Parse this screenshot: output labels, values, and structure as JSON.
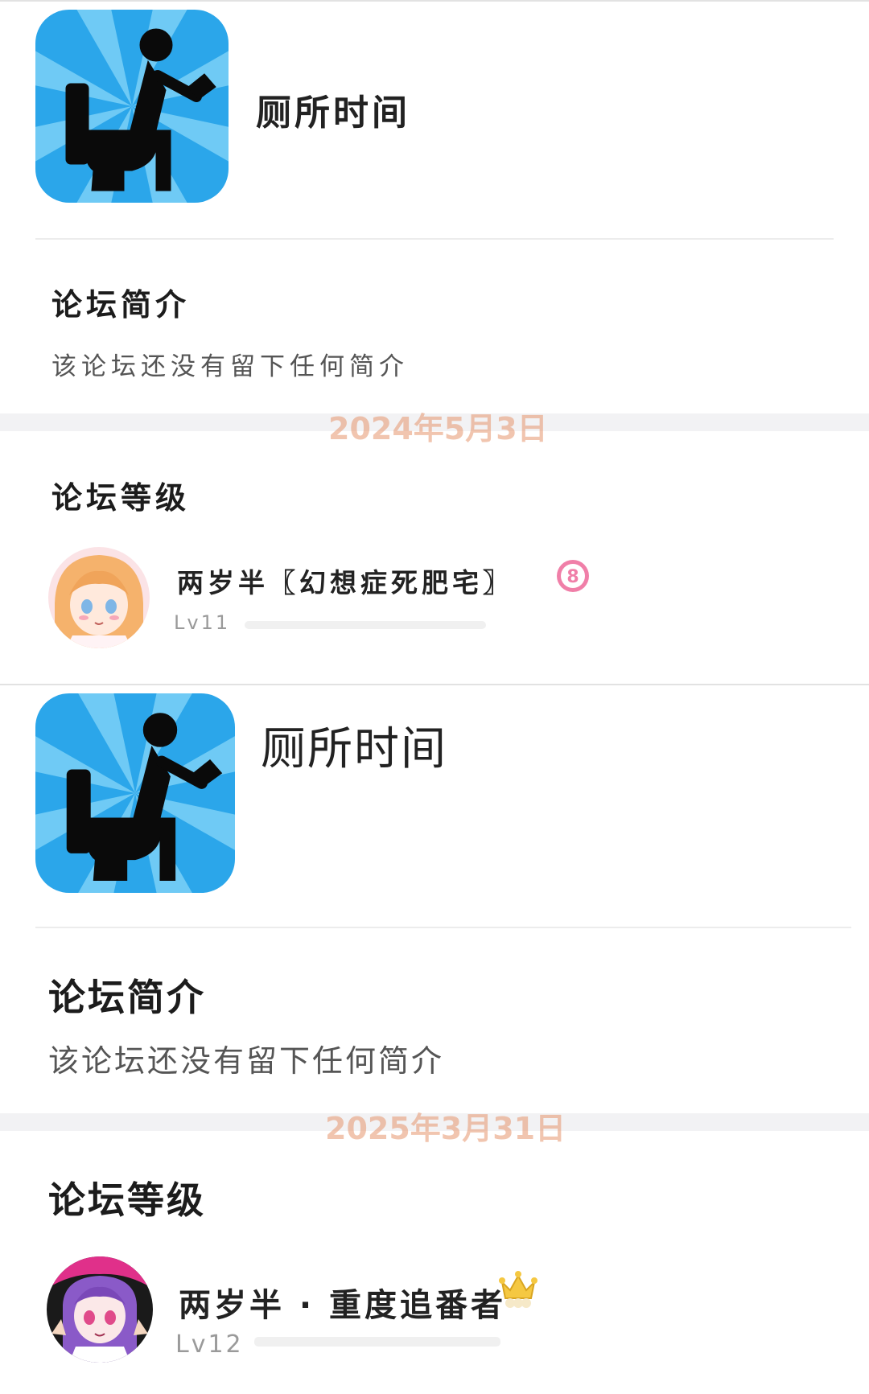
{
  "snapshots": [
    {
      "date": "2024年5月3日",
      "forum": {
        "name": "厕所时间",
        "icon": "toilet-reading-phone-icon"
      },
      "intro": {
        "title": "论坛简介",
        "text": "该论坛还没有留下任何简介"
      },
      "level_section": {
        "title": "论坛等级"
      },
      "user": {
        "name": "两岁半〖幻想症死肥宅〗",
        "level": "Lv11",
        "badge": {
          "icon": "number-8-badge-icon",
          "text": "8",
          "color": "#f07fa8"
        },
        "avatar": "anime-girl-orange-hair-avatar"
      }
    },
    {
      "date": "2025年3月31日",
      "forum": {
        "name": "厕所时间",
        "icon": "toilet-reading-phone-icon"
      },
      "intro": {
        "title": "论坛简介",
        "text": "该论坛还没有留下任何简介"
      },
      "level_section": {
        "title": "论坛等级"
      },
      "user": {
        "name": "两岁半 · 重度追番者",
        "level": "Lv12",
        "badge": {
          "icon": "crown-icon",
          "color": "#f5c842"
        },
        "avatar": "anime-girl-purple-hair-avatar"
      }
    }
  ],
  "colors": {
    "icon_bg": "#2ba6ea",
    "icon_rays": "#6fcaf5",
    "date_watermark": "#e8a07a"
  }
}
